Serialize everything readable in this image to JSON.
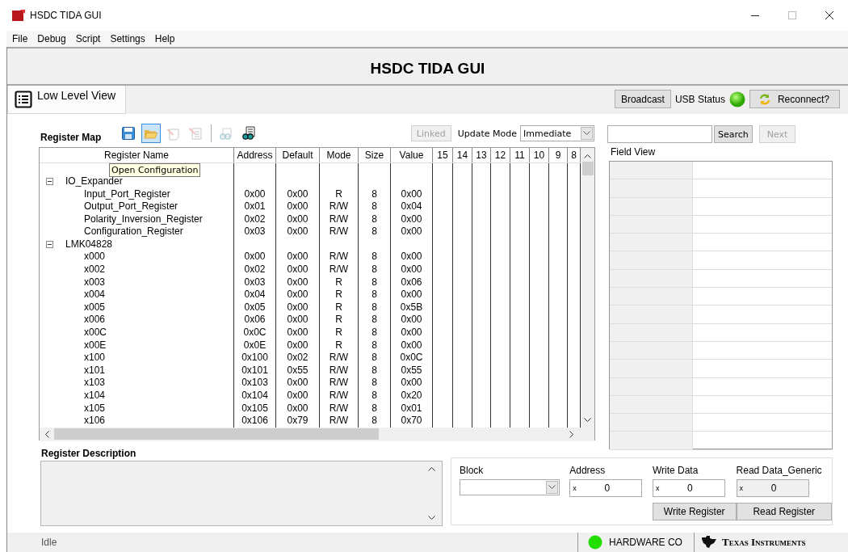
{
  "window": {
    "title": "HSDC TIDA GUI"
  },
  "menu": [
    "File",
    "Debug",
    "Script",
    "Settings",
    "Help"
  ],
  "header": {
    "title": "HSDC TIDA GUI"
  },
  "tabs": [
    {
      "label": "Low Level View",
      "selected": true
    }
  ],
  "connection": {
    "broadcast_button": "Broadcast",
    "usb_status_label": "USB Status",
    "usb_status_lit": true,
    "reconnect_button": "Reconnect?"
  },
  "register_map": {
    "title": "Register Map",
    "tools": [
      {
        "kind": "save",
        "hovered": false,
        "disabled": false
      },
      {
        "kind": "open",
        "hovered": true,
        "disabled": false
      },
      {
        "kind": "edit",
        "hovered": false,
        "disabled": true
      },
      {
        "kind": "edit-list",
        "hovered": false,
        "disabled": true
      },
      {
        "kind": "find",
        "hovered": false,
        "disabled": true
      },
      {
        "kind": "find-all",
        "hovered": false,
        "disabled": false
      }
    ],
    "tooltip": "Open Configuration",
    "linked_button": {
      "label": "Linked",
      "disabled": true
    },
    "update_mode": {
      "label": "Update Mode",
      "value": "Immediate"
    },
    "columns": [
      "Register Name",
      "Address",
      "Default",
      "Mode",
      "Size",
      "Value",
      "15",
      "14",
      "13",
      "12",
      "11",
      "10",
      "9",
      "8"
    ],
    "groups": [
      {
        "name": "IO_Expander",
        "expanded": true,
        "children": [
          {
            "name": "Input_Port_Register",
            "address": "0x00",
            "default": "0x00",
            "mode": "R",
            "size": "8",
            "value": "0x00"
          },
          {
            "name": "Output_Port_Register",
            "address": "0x01",
            "default": "0x00",
            "mode": "R/W",
            "size": "8",
            "value": "0x04"
          },
          {
            "name": "Polarity_Inversion_Register",
            "address": "0x02",
            "default": "0x00",
            "mode": "R/W",
            "size": "8",
            "value": "0x00"
          },
          {
            "name": "Configuration_Register",
            "address": "0x03",
            "default": "0x00",
            "mode": "R/W",
            "size": "8",
            "value": "0x00"
          }
        ]
      },
      {
        "name": "LMK04828",
        "expanded": true,
        "children": [
          {
            "name": "x000",
            "address": "0x00",
            "default": "0x00",
            "mode": "R/W",
            "size": "8",
            "value": "0x00"
          },
          {
            "name": "x002",
            "address": "0x02",
            "default": "0x00",
            "mode": "R/W",
            "size": "8",
            "value": "0x00"
          },
          {
            "name": "x003",
            "address": "0x03",
            "default": "0x00",
            "mode": "R",
            "size": "8",
            "value": "0x06"
          },
          {
            "name": "x004",
            "address": "0x04",
            "default": "0x00",
            "mode": "R",
            "size": "8",
            "value": "0x00"
          },
          {
            "name": "x005",
            "address": "0x05",
            "default": "0x00",
            "mode": "R",
            "size": "8",
            "value": "0x5B"
          },
          {
            "name": "x006",
            "address": "0x06",
            "default": "0x00",
            "mode": "R",
            "size": "8",
            "value": "0x00"
          },
          {
            "name": "x00C",
            "address": "0x0C",
            "default": "0x00",
            "mode": "R",
            "size": "8",
            "value": "0x00"
          },
          {
            "name": "x00E",
            "address": "0x0E",
            "default": "0x00",
            "mode": "R",
            "size": "8",
            "value": "0x00"
          },
          {
            "name": "x100",
            "address": "0x100",
            "default": "0x02",
            "mode": "R/W",
            "size": "8",
            "value": "0x0C"
          },
          {
            "name": "x101",
            "address": "0x101",
            "default": "0x55",
            "mode": "R/W",
            "size": "8",
            "value": "0x55"
          },
          {
            "name": "x103",
            "address": "0x103",
            "default": "0x00",
            "mode": "R/W",
            "size": "8",
            "value": "0x00"
          },
          {
            "name": "x104",
            "address": "0x104",
            "default": "0x00",
            "mode": "R/W",
            "size": "8",
            "value": "0x20"
          },
          {
            "name": "x105",
            "address": "0x105",
            "default": "0x00",
            "mode": "R/W",
            "size": "8",
            "value": "0x01"
          },
          {
            "name": "x106",
            "address": "0x106",
            "default": "0x79",
            "mode": "R/W",
            "size": "8",
            "value": "0x70"
          }
        ]
      }
    ]
  },
  "search": {
    "button": "Search",
    "next_button": {
      "label": "Next",
      "disabled": true
    }
  },
  "field_view": {
    "title": "Field View"
  },
  "register_description": {
    "title": "Register Description"
  },
  "register_access": {
    "block_label": "Block",
    "address": {
      "label": "Address",
      "prefix": "x",
      "value": "0"
    },
    "write_data": {
      "label": "Write Data",
      "prefix": "x",
      "value": "0"
    },
    "read_data": {
      "label": "Read Data_Generic",
      "prefix": "x",
      "value": "0"
    },
    "write_button": "Write Register",
    "read_button": "Read Register"
  },
  "status_bar": {
    "status": "Idle",
    "hardware_lit": true,
    "hardware_label": "HARDWARE CO",
    "logo": "Texas Instruments"
  }
}
